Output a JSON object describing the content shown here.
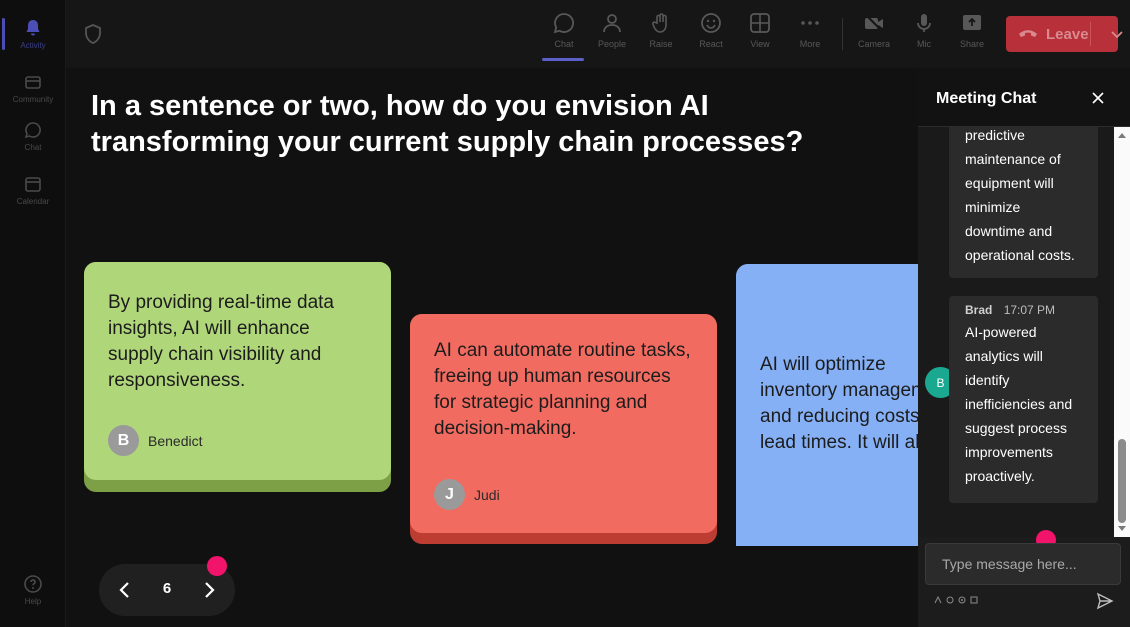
{
  "rail": {
    "items": [
      {
        "label": "Activity",
        "icon": "bell-icon"
      },
      {
        "label": "Community",
        "icon": "community-icon"
      },
      {
        "label": "Chat",
        "icon": "chat-icon"
      },
      {
        "label": "Calendar",
        "icon": "calendar-icon"
      },
      {
        "label": "Help",
        "icon": "help-icon"
      }
    ]
  },
  "toolbar": {
    "chat": "Chat",
    "people": "People",
    "raise": "Raise",
    "react": "React",
    "view": "View",
    "more": "More",
    "camera": "Camera",
    "mic": "Mic",
    "share": "Share",
    "leave": "Leave"
  },
  "stage": {
    "question": "In a sentence or two, how do you envision AI transforming your current supply chain processes?",
    "cards": [
      {
        "text": "By providing real-time data insights, AI will enhance supply chain visibility and responsiveness.",
        "author": "Benedict",
        "initial": "B",
        "color": "#b0d67a"
      },
      {
        "text": "AI can automate routine tasks, freeing up human resources for strategic planning and decision-making.",
        "author": "Judi",
        "initial": "J",
        "color": "#f26b60"
      },
      {
        "text": "AI will optimize inventory management and reducing costs and lead times. It will also",
        "color": "#85b0f5"
      }
    ],
    "page": "6"
  },
  "chat": {
    "title": "Meeting Chat",
    "messages": [
      {
        "text": "predictive maintenance of equipment will minimize downtime and operational costs."
      },
      {
        "sender": "Brad",
        "initial": "B",
        "time": "17:07 PM",
        "text": "AI-powered analytics will identify inefficiencies and suggest process improvements proactively."
      }
    ],
    "compose_placeholder": "Type message here..."
  },
  "colors": {
    "accent": "#5b5fc7",
    "leave": "#b8303a",
    "highlight_dot": "#f2136b"
  }
}
